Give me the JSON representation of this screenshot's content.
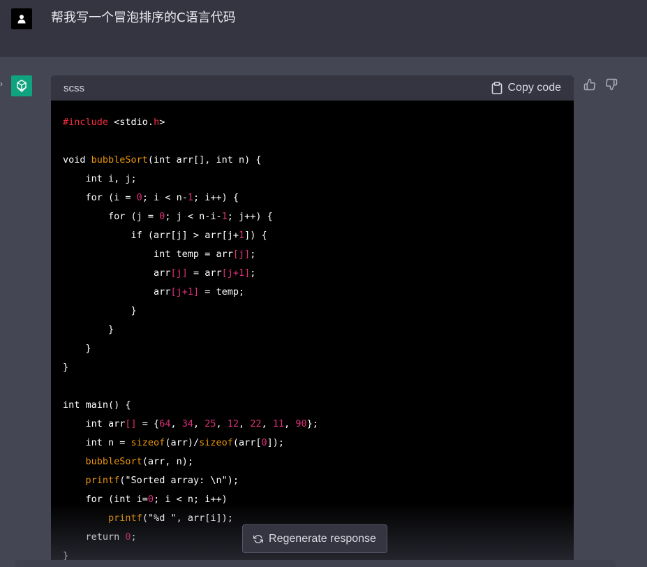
{
  "user": {
    "message": "帮我写一个冒泡排序的C语言代码"
  },
  "code_block": {
    "language": "scss",
    "copy_label": "Copy code",
    "lines": [
      [
        {
          "t": "#include",
          "c": "dir"
        },
        {
          "t": " <stdio.",
          "c": ""
        },
        {
          "t": "h",
          "c": "dir"
        },
        {
          "t": ">",
          "c": ""
        }
      ],
      [],
      [
        {
          "t": "void ",
          "c": ""
        },
        {
          "t": "bubbleSort",
          "c": "fn"
        },
        {
          "t": "(int arr[], int n) {",
          "c": ""
        }
      ],
      [
        {
          "t": "    int i, j;",
          "c": ""
        }
      ],
      [
        {
          "t": "    for (i = ",
          "c": ""
        },
        {
          "t": "0",
          "c": "num"
        },
        {
          "t": "; i < n-",
          "c": ""
        },
        {
          "t": "1",
          "c": "num"
        },
        {
          "t": "; i++) {",
          "c": ""
        }
      ],
      [
        {
          "t": "        for (j = ",
          "c": ""
        },
        {
          "t": "0",
          "c": "num"
        },
        {
          "t": "; j < n-i-",
          "c": ""
        },
        {
          "t": "1",
          "c": "num"
        },
        {
          "t": "; j++) {",
          "c": ""
        }
      ],
      [
        {
          "t": "            if (arr[j] > arr[j+",
          "c": ""
        },
        {
          "t": "1",
          "c": "num"
        },
        {
          "t": "]) {",
          "c": ""
        }
      ],
      [
        {
          "t": "                int temp = arr",
          "c": ""
        },
        {
          "t": "[j]",
          "c": "red"
        },
        {
          "t": ";",
          "c": ""
        }
      ],
      [
        {
          "t": "                arr",
          "c": ""
        },
        {
          "t": "[j]",
          "c": "red"
        },
        {
          "t": " = arr",
          "c": ""
        },
        {
          "t": "[j+1]",
          "c": "red"
        },
        {
          "t": ";",
          "c": ""
        }
      ],
      [
        {
          "t": "                arr",
          "c": ""
        },
        {
          "t": "[j+1]",
          "c": "red"
        },
        {
          "t": " = temp;",
          "c": ""
        }
      ],
      [
        {
          "t": "            }",
          "c": ""
        }
      ],
      [
        {
          "t": "        }",
          "c": ""
        }
      ],
      [
        {
          "t": "    }",
          "c": ""
        }
      ],
      [
        {
          "t": "}",
          "c": ""
        }
      ],
      [],
      [
        {
          "t": "int main() {",
          "c": ""
        }
      ],
      [
        {
          "t": "    int arr",
          "c": ""
        },
        {
          "t": "[]",
          "c": "red"
        },
        {
          "t": " = {",
          "c": ""
        },
        {
          "t": "64",
          "c": "num"
        },
        {
          "t": ", ",
          "c": ""
        },
        {
          "t": "34",
          "c": "num"
        },
        {
          "t": ", ",
          "c": ""
        },
        {
          "t": "25",
          "c": "num"
        },
        {
          "t": ", ",
          "c": ""
        },
        {
          "t": "12",
          "c": "num"
        },
        {
          "t": ", ",
          "c": ""
        },
        {
          "t": "22",
          "c": "num"
        },
        {
          "t": ", ",
          "c": ""
        },
        {
          "t": "11",
          "c": "num"
        },
        {
          "t": ", ",
          "c": ""
        },
        {
          "t": "90",
          "c": "num"
        },
        {
          "t": "};",
          "c": ""
        }
      ],
      [
        {
          "t": "    int n = ",
          "c": ""
        },
        {
          "t": "sizeof",
          "c": "fn"
        },
        {
          "t": "(arr)/",
          "c": ""
        },
        {
          "t": "sizeof",
          "c": "fn"
        },
        {
          "t": "(arr[",
          "c": ""
        },
        {
          "t": "0",
          "c": "num"
        },
        {
          "t": "]);",
          "c": ""
        }
      ],
      [
        {
          "t": "    ",
          "c": ""
        },
        {
          "t": "bubbleSort",
          "c": "fn"
        },
        {
          "t": "(arr, n);",
          "c": ""
        }
      ],
      [
        {
          "t": "    ",
          "c": ""
        },
        {
          "t": "printf",
          "c": "fn"
        },
        {
          "t": "(\"Sorted array: \\n\");",
          "c": ""
        }
      ],
      [
        {
          "t": "    for (int i=",
          "c": ""
        },
        {
          "t": "0",
          "c": "num"
        },
        {
          "t": "; i < n; i++)",
          "c": ""
        }
      ],
      [
        {
          "t": "        ",
          "c": ""
        },
        {
          "t": "printf",
          "c": "fn"
        },
        {
          "t": "(\"%d \", arr[i]);",
          "c": ""
        }
      ],
      [
        {
          "t": "    return ",
          "c": ""
        },
        {
          "t": "0",
          "c": "num"
        },
        {
          "t": ";",
          "c": ""
        }
      ],
      [
        {
          "t": "}",
          "c": ""
        }
      ]
    ]
  },
  "regenerate": {
    "label": "Regenerate response"
  },
  "icons": {
    "user_avatar": "user-icon",
    "bot_avatar": "openai-logo-icon",
    "copy": "clipboard-icon",
    "regen": "refresh-icon",
    "thumbs_up": "thumbs-up-icon",
    "thumbs_down": "thumbs-down-icon",
    "chevron": "chevron-right-icon"
  },
  "colors": {
    "page_bg": "#444654",
    "user_row_bg": "#343541",
    "code_bg": "#000000",
    "code_header_bg": "#343541",
    "accent_green": "#10a37f",
    "keyword_red": "#f22c3d",
    "function_orange": "#e9950c",
    "number_pink": "#df3079"
  }
}
